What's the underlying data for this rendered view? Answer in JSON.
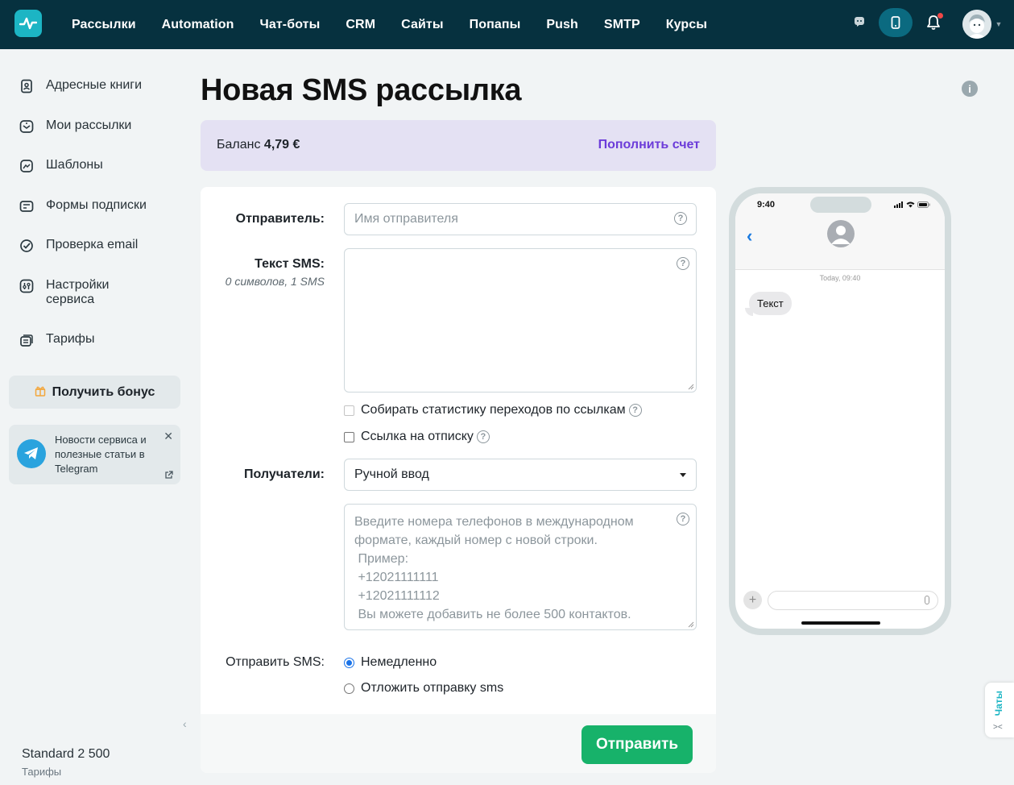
{
  "topbar": {
    "nav": [
      "Рассылки",
      "Automation",
      "Чат-боты",
      "CRM",
      "Сайты",
      "Попапы",
      "Push",
      "SMTP",
      "Курсы"
    ]
  },
  "sidebar": {
    "items": [
      {
        "label": "Адресные книги",
        "icon": "address-book-icon"
      },
      {
        "label": "Мои рассылки",
        "icon": "mailings-icon"
      },
      {
        "label": "Шаблоны",
        "icon": "templates-icon"
      },
      {
        "label": "Формы подписки",
        "icon": "subscription-forms-icon"
      },
      {
        "label": "Проверка email",
        "icon": "email-check-icon"
      },
      {
        "label": "Настройки\nсервиса",
        "icon": "settings-icon"
      },
      {
        "label": "Тарифы",
        "icon": "tariffs-icon"
      }
    ],
    "bonus_label": "Получить бонус",
    "telegram_text": "Новости сервиса и полезные статьи в Telegram",
    "plan_name": "Standard 2 500",
    "plan_link": "Тарифы"
  },
  "page": {
    "title": "Новая SMS рассылка"
  },
  "balance": {
    "label": "Баланс",
    "amount": "4,79 €",
    "topup": "Пополнить счет"
  },
  "form": {
    "sender_label": "Отправитель:",
    "sender_placeholder": "Имя отправителя",
    "text_label": "Текст SMS:",
    "text_counter": "0 символов, 1 SMS",
    "track_links": "Собирать статистику переходов по ссылкам",
    "unsubscribe_link": "Ссылка на отписку",
    "recipients_label": "Получатели:",
    "recipients_value": "Ручной ввод",
    "phones_placeholder": "Введите номера телефонов в международном\nформате, каждый номер с новой строки.\n Пример:\n +12021111111\n +12021111112\n Вы можете добавить не более 500 контактов.",
    "send_label": "Отправить SMS:",
    "send_now": "Немедленно",
    "send_later": "Отложить отправку sms",
    "submit": "Отправить"
  },
  "preview": {
    "clock": "9:40",
    "timestamp": "Today, 09:40",
    "message": "Текст"
  },
  "chats_tab": {
    "label": "Чаты"
  },
  "colors": {
    "topbar": "#06313f",
    "accent": "#1cb5c4",
    "primary_button": "#17b26a",
    "link": "#6c3cd9",
    "balance_bg": "#e4e1f3"
  }
}
